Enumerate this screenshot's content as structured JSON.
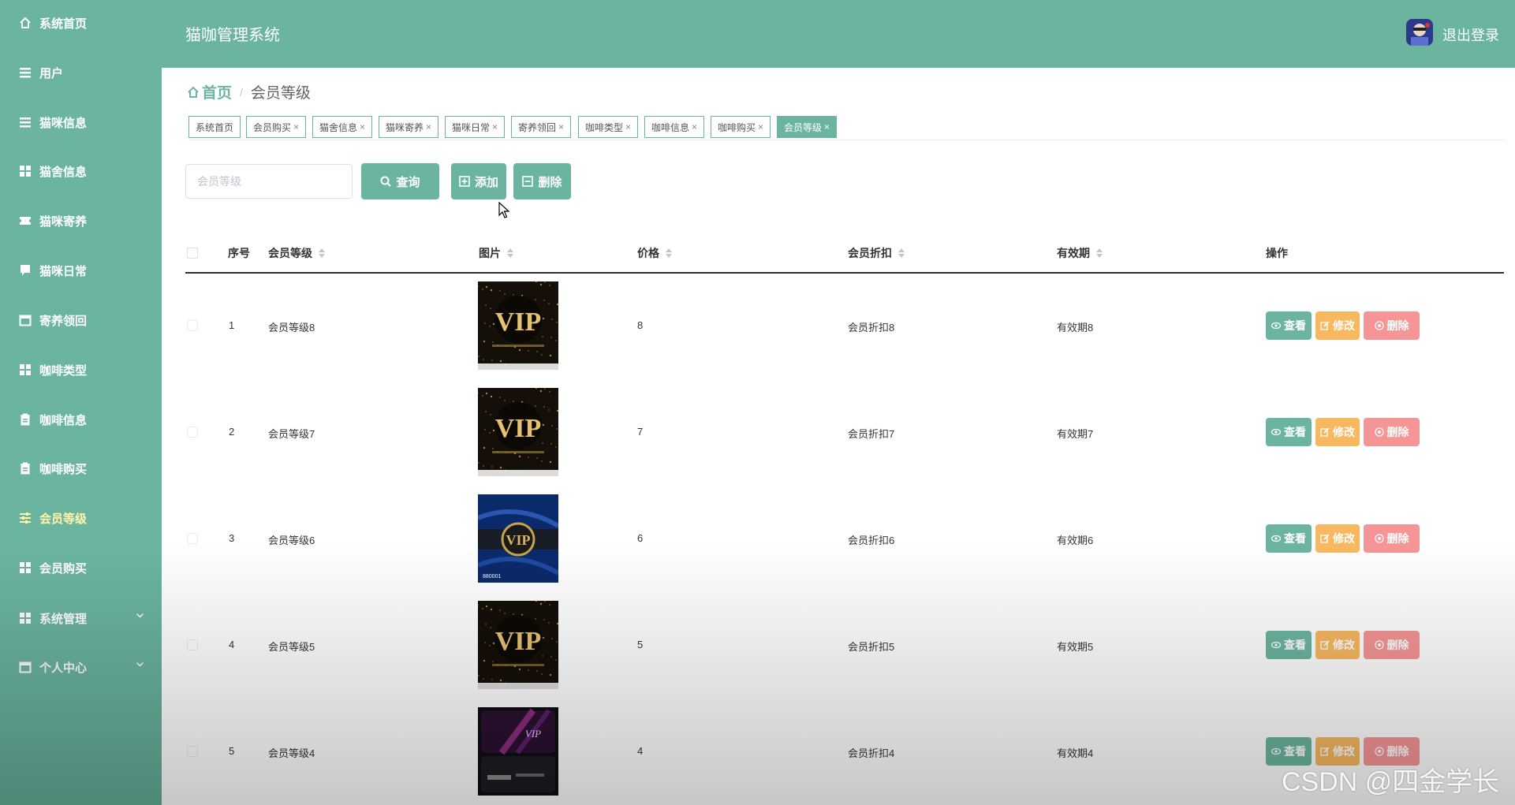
{
  "app": {
    "title": "猫咖管理系统",
    "logout_label": "退出登录"
  },
  "sidebar": {
    "items": [
      {
        "label": "系统首页",
        "icon": "home-icon"
      },
      {
        "label": "用户",
        "icon": "list-icon"
      },
      {
        "label": "猫咪信息",
        "icon": "list-icon"
      },
      {
        "label": "猫舍信息",
        "icon": "grid-icon"
      },
      {
        "label": "猫咪寄养",
        "icon": "ticket-icon"
      },
      {
        "label": "猫咪日常",
        "icon": "message-icon"
      },
      {
        "label": "寄养领回",
        "icon": "calendar-icon"
      },
      {
        "label": "咖啡类型",
        "icon": "grid-icon"
      },
      {
        "label": "咖啡信息",
        "icon": "clipboard-icon"
      },
      {
        "label": "咖啡购买",
        "icon": "clipboard-icon"
      },
      {
        "label": "会员等级",
        "icon": "sliders-icon",
        "active": true
      },
      {
        "label": "会员购买",
        "icon": "grid-icon"
      },
      {
        "label": "系统管理",
        "icon": "grid-icon",
        "expandable": true
      },
      {
        "label": "个人中心",
        "icon": "calendar-icon",
        "expandable": true
      }
    ],
    "active_color": "#fff6a8"
  },
  "breadcrumb": {
    "home": "首页",
    "separator": "/",
    "current": "会员等级"
  },
  "tabs": [
    {
      "label": "系统首页",
      "closable": false
    },
    {
      "label": "会员购买",
      "closable": true
    },
    {
      "label": "猫舍信息",
      "closable": true
    },
    {
      "label": "猫咪寄养",
      "closable": true
    },
    {
      "label": "猫咪日常",
      "closable": true
    },
    {
      "label": "寄养领回",
      "closable": true
    },
    {
      "label": "咖啡类型",
      "closable": true
    },
    {
      "label": "咖啡信息",
      "closable": true
    },
    {
      "label": "咖啡购买",
      "closable": true
    },
    {
      "label": "会员等级",
      "closable": true,
      "active": true
    }
  ],
  "toolbar": {
    "search_placeholder": "会员等级",
    "search_value": "",
    "query_label": "查询",
    "add_label": "添加",
    "delete_label": "删除"
  },
  "table": {
    "columns": [
      "序号",
      "会员等级",
      "图片",
      "价格",
      "会员折扣",
      "有效期",
      "操作"
    ],
    "rows": [
      {
        "index": "1",
        "level": "会员等级8",
        "image": "vip-gold",
        "price": "8",
        "discount": "会员折扣8",
        "validity": "有效期8"
      },
      {
        "index": "2",
        "level": "会员等级7",
        "image": "vip-gold",
        "price": "7",
        "discount": "会员折扣7",
        "validity": "有效期7"
      },
      {
        "index": "3",
        "level": "会员等级6",
        "image": "vip-blue",
        "price": "6",
        "discount": "会员折扣6",
        "validity": "有效期6"
      },
      {
        "index": "4",
        "level": "会员等级5",
        "image": "vip-gold",
        "price": "5",
        "discount": "会员折扣5",
        "validity": "有效期5"
      },
      {
        "index": "5",
        "level": "会员等级4",
        "image": "vip-dark",
        "price": "4",
        "discount": "会员折扣4",
        "validity": "有效期4"
      }
    ],
    "actions": {
      "view": "查看",
      "edit": "修改",
      "delete": "删除"
    }
  },
  "colors": {
    "primary": "#6bb5a0",
    "view": "#6bb5a0",
    "edit": "#f7b860",
    "delete": "#f59595"
  },
  "watermark": "CSDN @四金学长"
}
